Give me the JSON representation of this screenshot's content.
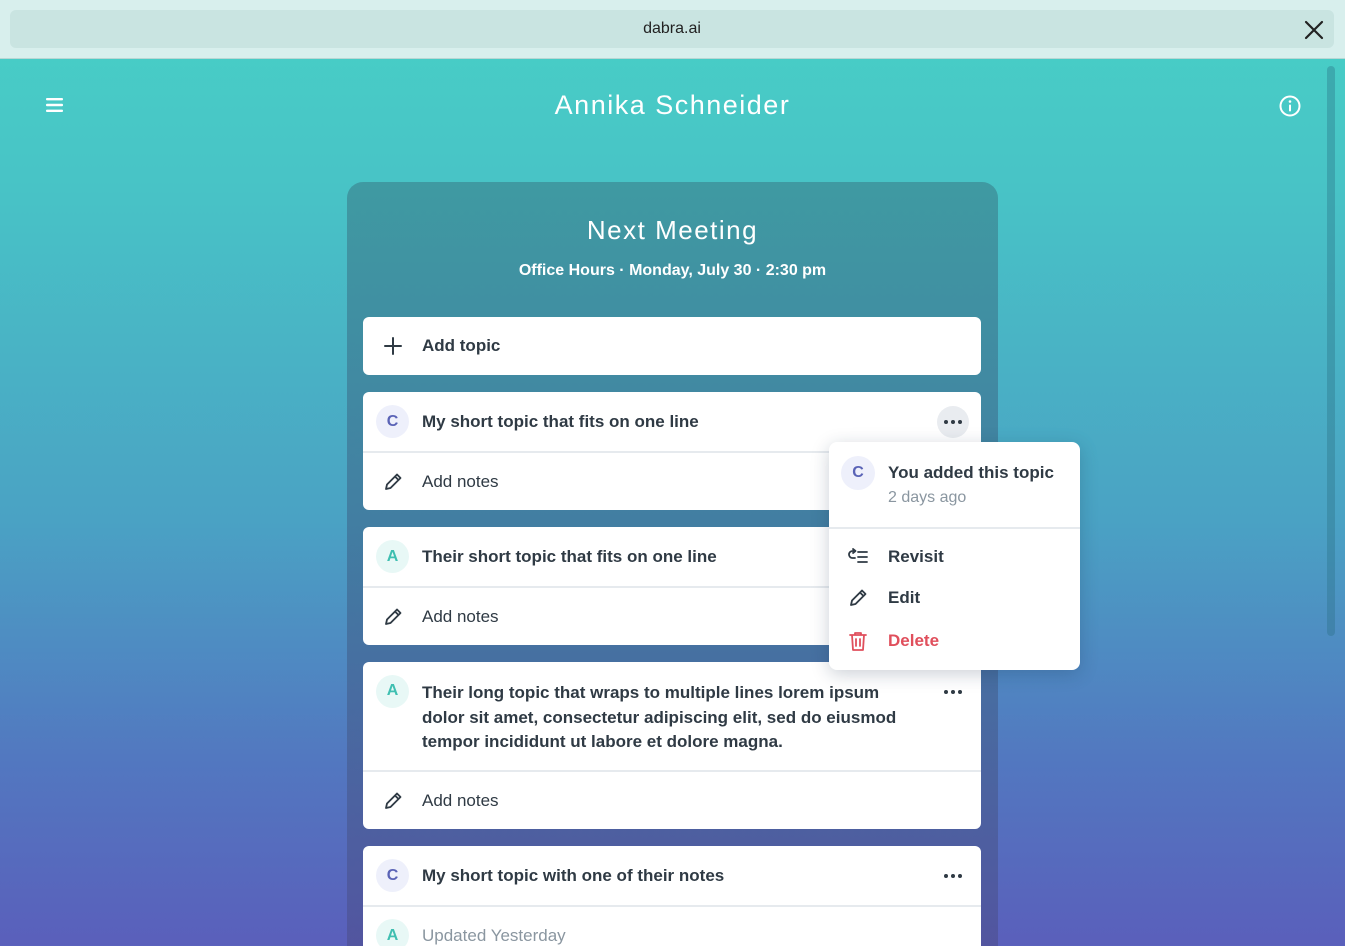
{
  "browser": {
    "url": "dabra.ai"
  },
  "header": {
    "title": "Annika Schneider"
  },
  "meeting": {
    "title": "Next Meeting",
    "subtitle": "Office Hours · Monday, July 30 · 2:30 pm",
    "add_topic_label": "Add topic",
    "topics": [
      {
        "avatar": "C",
        "title": "My short topic that fits on one line",
        "notes_label": "Add notes"
      },
      {
        "avatar": "A",
        "title": "Their short topic that fits on one line",
        "notes_label": "Add notes"
      },
      {
        "avatar": "A",
        "title": "Their long topic that wraps to multiple lines lorem ipsum dolor sit amet, consectetur adipiscing elit, sed do eiusmod tempor incididunt ut labore et dolore magna.",
        "notes_label": "Add notes"
      },
      {
        "avatar": "C",
        "title": "My short topic with one of their notes",
        "note_avatar": "A",
        "note_text": "Updated Yesterday"
      }
    ]
  },
  "popover": {
    "avatar": "C",
    "title": "You added this topic",
    "time": "2 days ago",
    "items": [
      {
        "label": "Revisit",
        "icon": "revisit-icon"
      },
      {
        "label": "Edit",
        "icon": "pencil-icon"
      },
      {
        "label": "Delete",
        "icon": "trash-icon"
      }
    ]
  },
  "colors": {
    "teal_accent": "#3fbfb1",
    "indigo_accent": "#5a63b6",
    "danger": "#e04f5c"
  }
}
